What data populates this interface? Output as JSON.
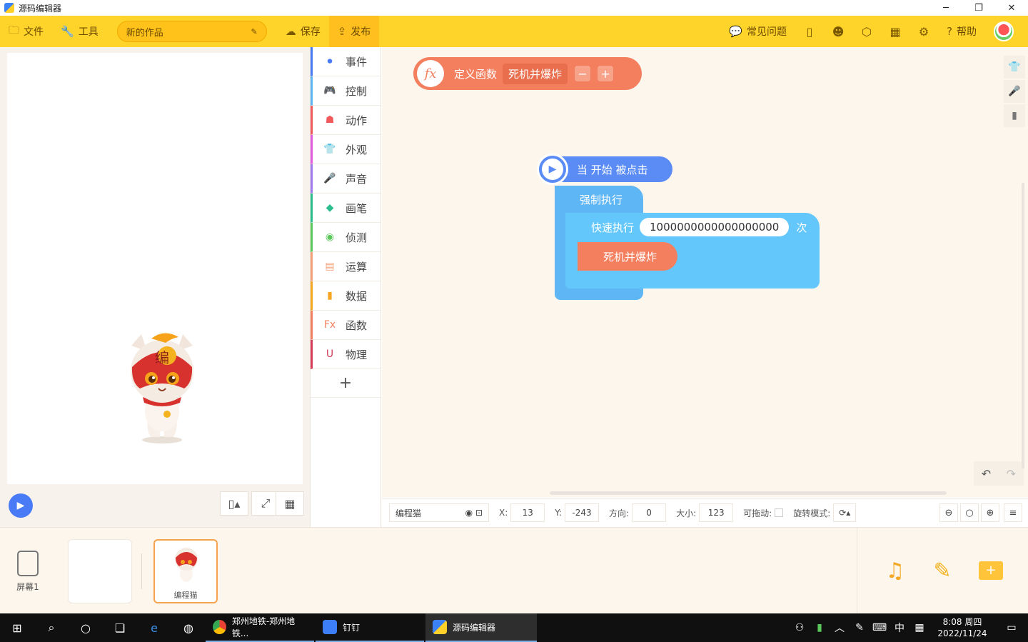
{
  "window": {
    "title": "源码编辑器",
    "minimize": "─",
    "restore": "❐",
    "close": "✕"
  },
  "toolbar": {
    "file": "文件",
    "tools": "工具",
    "work_name": "新的作品",
    "save": "保存",
    "publish": "发布",
    "faq": "常见问题",
    "help": "帮助"
  },
  "categories": [
    {
      "label": "事件",
      "color": "#4a7bf7"
    },
    {
      "label": "控制",
      "color": "#5fb6f5"
    },
    {
      "label": "动作",
      "color": "#f05a5a"
    },
    {
      "label": "外观",
      "color": "#e25be0"
    },
    {
      "label": "声音",
      "color": "#a07af0"
    },
    {
      "label": "画笔",
      "color": "#2bbf8f"
    },
    {
      "label": "侦测",
      "color": "#5bc85b"
    },
    {
      "label": "运算",
      "color": "#f5a27a"
    },
    {
      "label": "数据",
      "color": "#f5a623"
    },
    {
      "label": "函数",
      "color": "#f47f5f"
    },
    {
      "label": "物理",
      "color": "#d63b5a"
    }
  ],
  "blocks": {
    "define_label": "定义函数",
    "function_name": "死机并爆炸",
    "minus": "−",
    "plus": "+",
    "start_label": "当 开始 被点击",
    "forever_label": "强制执行",
    "repeat_label": "快速执行",
    "repeat_count": "1000000000000000000",
    "repeat_unit": "次",
    "call_name": "死机并爆炸"
  },
  "props": {
    "sprite_name": "编程猫",
    "x_label": "X:",
    "x": "13",
    "y_label": "Y:",
    "y": "-243",
    "dir_label": "方向:",
    "dir": "0",
    "size_label": "大小:",
    "size": "123",
    "drag_label": "可拖动:",
    "rotate_label": "旋转模式:"
  },
  "bottom": {
    "screen_label": "屏幕1",
    "sprite_label": "编程猫"
  },
  "taskbar": {
    "app1": "郑州地铁-郑州地铁...",
    "app2": "钉钉",
    "app3": "源码编辑器",
    "ime": "中",
    "time": "8:08 周四",
    "date": "2022/11/24"
  },
  "colors": {
    "toolbar": "#ffd42a",
    "function": "#f47f5f",
    "event": "#5b8cf5",
    "control": "#5fb6f5"
  }
}
